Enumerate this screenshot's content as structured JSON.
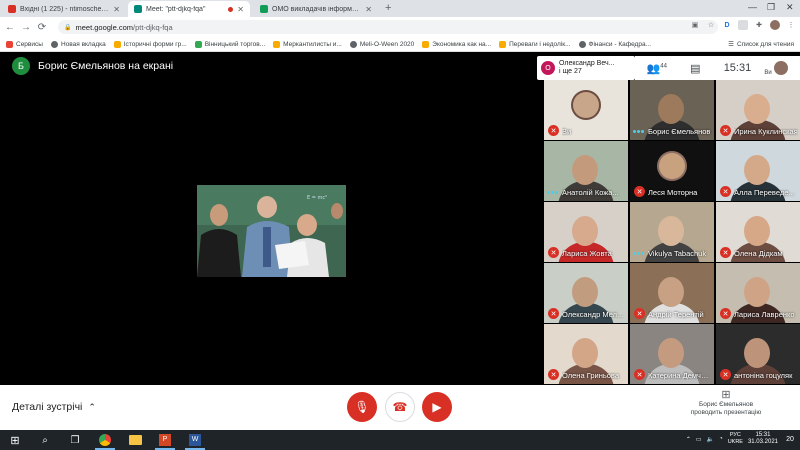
{
  "browser": {
    "tabs": [
      {
        "title": "Вхідні (1 225) - ntimoschenkom@",
        "favicon_color": "#d93025",
        "active": false
      },
      {
        "title": "Meet: \"ptt-djkq-fqa\"",
        "favicon_color": "#00897b",
        "active": true,
        "recording": true
      },
      {
        "title": "ОМО викладачів інформатики",
        "favicon_color": "#0f9d58",
        "active": false
      }
    ],
    "new_tab": "+",
    "url_host": "meet.google.com",
    "url_path": "/ptt-djkq-fqa",
    "bookmarks": [
      {
        "label": "Сервисы",
        "color": "#ea4335"
      },
      {
        "label": "Новая вкладка",
        "color": "#5f6368"
      },
      {
        "label": "Історичні форми гр...",
        "color": "#f9ab00"
      },
      {
        "label": "Вінницький торгов...",
        "color": "#34a853"
      },
      {
        "label": "Меркантилисты и...",
        "color": "#f9ab00"
      },
      {
        "label": "Meli-O-Ween 2020",
        "color": "#5f6368"
      },
      {
        "label": "Экономика как на...",
        "color": "#f9ab00"
      },
      {
        "label": "Переваги і недолік...",
        "color": "#f9ab00"
      },
      {
        "label": "Фінанси - Кафедра...",
        "color": "#5f6368"
      }
    ],
    "reading_list": "Список для чтения"
  },
  "meet": {
    "presenter_initial": "Б",
    "presenter_title": "Борис Ємельянов на екрані",
    "people_chip": {
      "initial": "О",
      "line1": "Олександр Веч...",
      "line2": "і ще 27"
    },
    "participant_count": "44",
    "time": "15:31",
    "self_label": "Ви",
    "tiles": [
      {
        "name": "Ви",
        "muted": true,
        "bg": "#e8e4dc",
        "skin": "#c8a68a",
        "shirt": "#6d4c41",
        "avatar_style": true
      },
      {
        "name": "Борис Ємельянов",
        "muted": false,
        "speaking": true,
        "bg": "#6b6256",
        "skin": "#9c7a5b",
        "shirt": "#2e2e2e"
      },
      {
        "name": "Ирина Куклинская",
        "muted": true,
        "bg": "#d5cfc8",
        "skin": "#d9ae8e",
        "shirt": "#5d4037"
      },
      {
        "name": "Анатолій Кожа...",
        "muted": false,
        "bg": "#a8b7a5",
        "skin": "#c49a7d",
        "shirt": "#3e3b38"
      },
      {
        "name": "Леся Моторна",
        "muted": true,
        "bg": "#101010",
        "skin": "#c8a27e",
        "shirt": "#8d6e63",
        "avatar_style": true
      },
      {
        "name": "Алла Переведе...",
        "muted": true,
        "bg": "#cfd8dc",
        "skin": "#d4a98a",
        "shirt": "#263238"
      },
      {
        "name": "Лариса Жовта",
        "muted": true,
        "bg": "#d7d0c8",
        "skin": "#d7a98d",
        "shirt": "#c62828"
      },
      {
        "name": "Vikulya Tabachuk",
        "muted": false,
        "bg": "#b6a890",
        "skin": "#d9b79a",
        "shirt": "#424242"
      },
      {
        "name": "Олена Дідкам",
        "muted": true,
        "bg": "#e0dbd4",
        "skin": "#d6a887",
        "shirt": "#6d4c41"
      },
      {
        "name": "Олександр Мел...",
        "muted": true,
        "bg": "#c9cfc6",
        "skin": "#c29c7f",
        "shirt": "#37474f"
      },
      {
        "name": "Андрій Терентій",
        "muted": true,
        "bg": "#8b6f57",
        "skin": "#c8a084",
        "shirt": "#e0e0e0"
      },
      {
        "name": "Лариса Лавренко",
        "muted": true,
        "bg": "#c5beb0",
        "skin": "#cfa486",
        "shirt": "#3e2723"
      },
      {
        "name": "Олена Гриньова",
        "muted": true,
        "bg": "#e3d9cc",
        "skin": "#d3a687",
        "shirt": "#795548"
      },
      {
        "name": "Катерина Демченко",
        "muted": true,
        "bg": "#8a8580",
        "skin": "#c59b80",
        "shirt": "#bdbdbd"
      },
      {
        "name": "антоніна гоцуляк",
        "muted": true,
        "bg": "#2c2c2c",
        "skin": "#bd947a",
        "shirt": "#5d4037"
      }
    ],
    "controls": {
      "details_label": "Деталі зустрічі",
      "presenting_line1": "Борис Ємельянов",
      "presenting_line2": "проводить презентацію"
    }
  },
  "taskbar": {
    "lang_top": "РУС",
    "lang_bottom": "UKRE",
    "clock_time": "15:31",
    "clock_date": "31.03.2021",
    "notifications": "20"
  }
}
